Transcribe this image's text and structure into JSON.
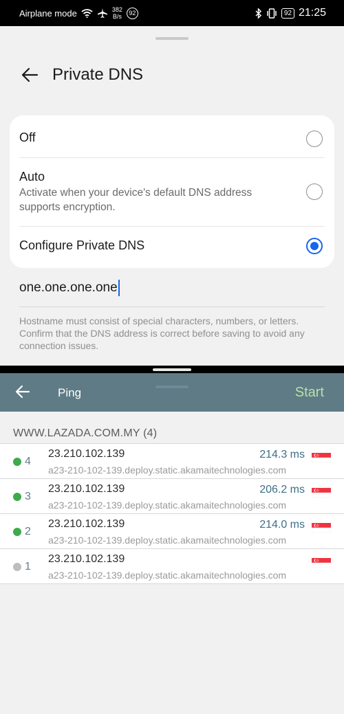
{
  "statusbar": {
    "mode": "Airplane mode",
    "speed_value": "382",
    "speed_unit": "B/s",
    "badge": "92",
    "battery": "92",
    "time": "21:25"
  },
  "settings": {
    "title": "Private DNS",
    "options": [
      {
        "label": "Off",
        "description": "",
        "selected": false
      },
      {
        "label": "Auto",
        "description": "Activate when your device's default DNS address supports encryption.",
        "selected": false
      },
      {
        "label": "Configure Private DNS",
        "description": "",
        "selected": true
      }
    ],
    "hostname_value": "one.one.one.one",
    "hint": "Hostname must consist of special characters, numbers, or letters. Confirm that the DNS address is correct before saving to avoid any connection issues."
  },
  "ping": {
    "title": "Ping",
    "start_label": "Start",
    "group_header": "WWW.LAZADA.COM.MY (4)",
    "rows": [
      {
        "seq": "4",
        "ip": "23.210.102.139",
        "host": "a23-210-102-139.deploy.static.akamaitechnologies.com",
        "ms": "214.3 ms",
        "status": "ok"
      },
      {
        "seq": "3",
        "ip": "23.210.102.139",
        "host": "a23-210-102-139.deploy.static.akamaitechnologies.com",
        "ms": "206.2 ms",
        "status": "ok"
      },
      {
        "seq": "2",
        "ip": "23.210.102.139",
        "host": "a23-210-102-139.deploy.static.akamaitechnologies.com",
        "ms": "214.0 ms",
        "status": "ok"
      },
      {
        "seq": "1",
        "ip": "23.210.102.139",
        "host": "a23-210-102-139.deploy.static.akamaitechnologies.com",
        "ms": "",
        "status": "pending"
      }
    ]
  },
  "colors": {
    "accent": "#1764ee",
    "appbar": "#5f7b86",
    "start": "#b8e2a2",
    "ok": "#3daa4c",
    "pending": "#bdbdbd",
    "ms_text": "#3d6e87"
  },
  "icons": {
    "wifi": "wifi-icon",
    "airplane": "airplane-icon",
    "bluetooth": "bluetooth-icon",
    "vibrate": "vibrate-icon",
    "back": "arrow-left-icon",
    "flag": "singapore-flag-icon"
  }
}
